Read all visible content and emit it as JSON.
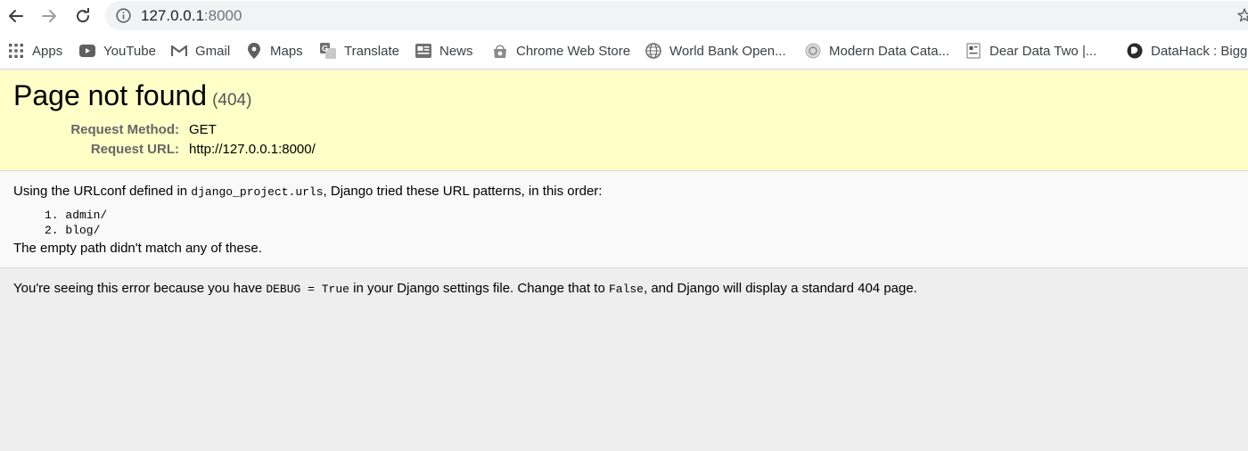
{
  "browser": {
    "url_host": "127.0.0.1",
    "url_port": ":8000",
    "bookmarks": [
      {
        "label": "Apps",
        "icon": "apps-grid-icon"
      },
      {
        "label": "YouTube",
        "icon": "youtube-icon"
      },
      {
        "label": "Gmail",
        "icon": "gmail-icon"
      },
      {
        "label": "Maps",
        "icon": "maps-pin-icon"
      },
      {
        "label": "Translate",
        "icon": "translate-icon"
      },
      {
        "label": "News",
        "icon": "news-icon"
      },
      {
        "label": "Chrome Web Store",
        "icon": "chrome-web-store-icon"
      },
      {
        "label": "World Bank Open...",
        "icon": "globe-icon"
      },
      {
        "label": "Modern Data Cata...",
        "icon": "site-favicon-icon"
      },
      {
        "label": "Dear Data Two |...",
        "icon": "site-favicon-icon"
      },
      {
        "label": "DataHack : Bigge",
        "icon": "datahack-icon"
      }
    ]
  },
  "error": {
    "title": "Page not found",
    "code": "(404)",
    "request_method_label": "Request Method:",
    "request_method": "GET",
    "request_url_label": "Request URL:",
    "request_url": "http://127.0.0.1:8000/"
  },
  "info": {
    "intro_before": "Using the URLconf defined in ",
    "urlconf": "django_project.urls",
    "intro_after": ", Django tried these URL patterns, in this order:",
    "patterns": [
      "1.  admin/",
      "2.  blog/"
    ],
    "no_match": "The empty path didn't match any of these."
  },
  "explanation": {
    "part1": "You're seeing this error because you have ",
    "debug_code": "DEBUG = True",
    "part2": " in your Django settings file. Change that to ",
    "false_code": "False",
    "part3": ", and Django will display a standard 404 page."
  },
  "colors": {
    "summary_bg": "#ffffc8",
    "page_bg": "#eeeeee",
    "info_bg": "#f9f9f9"
  }
}
